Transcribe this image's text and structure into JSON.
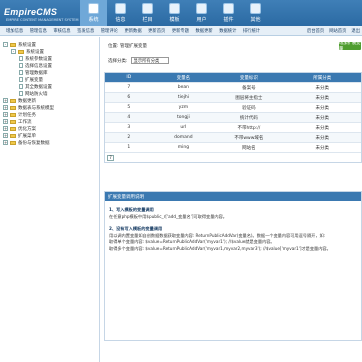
{
  "header": {
    "logo": "EmpireCMS",
    "logo_sub": "EMPIRE CONTENT MANAGEMENT SYSTEM",
    "nav": [
      {
        "label": "系统",
        "icon": "system-icon",
        "active": true
      },
      {
        "label": "信息",
        "icon": "info-icon"
      },
      {
        "label": "栏目",
        "icon": "column-icon"
      },
      {
        "label": "模板",
        "icon": "template-icon"
      },
      {
        "label": "用户",
        "icon": "user-icon"
      },
      {
        "label": "插件",
        "icon": "plugin-icon"
      },
      {
        "label": "其他",
        "icon": "other-icon"
      }
    ]
  },
  "subnav": {
    "items": [
      "增加信息",
      "管理信息",
      "审核信息",
      "签发信息",
      "管理评论",
      "更新数据",
      "更新首页",
      "更新专题",
      "数据更新",
      "数据统计",
      "排行统计"
    ],
    "right": [
      "后台首页",
      "网站首页",
      "退出"
    ]
  },
  "sidebar": {
    "items": [
      {
        "label": "系统设置",
        "level": 0,
        "type": "root"
      },
      {
        "label": "系统设置",
        "level": 1,
        "type": "folder"
      },
      {
        "label": "系统参数设置",
        "level": 2,
        "type": "page"
      },
      {
        "label": "选择信息设置",
        "level": 2,
        "type": "page"
      },
      {
        "label": "管理数据库",
        "level": 2,
        "type": "page"
      },
      {
        "label": "扩展变量",
        "level": 2,
        "type": "page"
      },
      {
        "label": "其全数据设置",
        "level": 2,
        "type": "page"
      },
      {
        "label": "网站防火墙",
        "level": 2,
        "type": "page"
      },
      {
        "label": "数据更新",
        "level": 0,
        "type": "group"
      },
      {
        "label": "数据表与系统模型",
        "level": 0,
        "type": "group"
      },
      {
        "label": "计划任务",
        "level": 0,
        "type": "group"
      },
      {
        "label": "工作流",
        "level": 0,
        "type": "group"
      },
      {
        "label": "优化方案",
        "level": 0,
        "type": "group"
      },
      {
        "label": "扩展菜单",
        "level": 0,
        "type": "group"
      },
      {
        "label": "备份与恢复数据",
        "level": 0,
        "type": "group"
      }
    ]
  },
  "main": {
    "breadcrumb": "位置: 管理扩展变量",
    "add_button": "增加扩展变量",
    "filter_label": "选择分类:",
    "filter_value": "显示所有分类"
  },
  "table": {
    "headers": [
      "ID",
      "变量名",
      "变量标识",
      "所属分类"
    ],
    "rows": [
      {
        "id": "7",
        "name": "bean",
        "label": "备案号",
        "category": "未分类"
      },
      {
        "id": "6",
        "name": "tiejhi",
        "label": "图层将主指士",
        "category": "未分类"
      },
      {
        "id": "5",
        "name": "yzm",
        "label": "验证码",
        "category": "未分类"
      },
      {
        "id": "4",
        "name": "tongji",
        "label": "统计代码",
        "category": "未分类"
      },
      {
        "id": "3",
        "name": "url",
        "label": "不带http://",
        "category": "未分类"
      },
      {
        "id": "2",
        "name": "domand",
        "label": "不带www域名",
        "category": "未分类"
      },
      {
        "id": "1",
        "name": "ming",
        "label": "网站名",
        "category": "未分类"
      }
    ],
    "page": "7"
  },
  "help": {
    "title": "扩展变量调用说明",
    "section1_title": "1、写入模板的变量调用",
    "section1_text": "在任意php模板中用$public_r['add_变量名']可取得变量内容。",
    "section2_title": "2、没有写入模板的变量调用",
    "section2_line1": "用以调内置变量如自创数据数据获取变量内容:  ReturnPublicAddVar(变量名)。数据一个变量内容可用逗号隔开，如:",
    "section2_line2": "取得单个变量内容: $value=ReturnPublicAddVar('myvar1'); //$value就是变量内容。",
    "section2_line3": "取得多个变量内容: $value=ReturnPublicAddVar('myvar1,myvar2,myvar3'); //$value['myvar1']才是变量内容。"
  },
  "colors": {
    "header_blue": "#2b6aa3",
    "table_header": "#3b79b1",
    "add_button_green": "#4f9d2f"
  }
}
